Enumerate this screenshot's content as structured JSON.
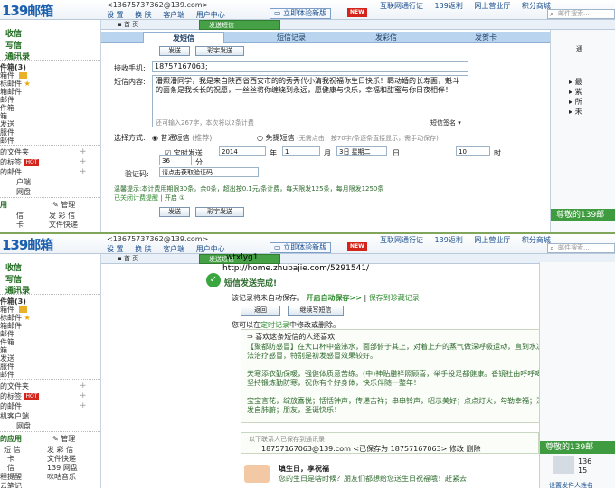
{
  "header": {
    "logo": "139邮箱",
    "account": "<13675737362@139.com>",
    "links": [
      "设 置",
      "换 肤",
      "客户端",
      "用户中心"
    ],
    "try_new": "立即体验新版",
    "new_badge": "NEW",
    "right_links": [
      "互联网通行证",
      "139返利",
      "网上营业厅",
      "积分商城"
    ],
    "search_placeholder": "邮件搜索..."
  },
  "sidebar_top": {
    "inbox": "收信",
    "compose": "写信",
    "contacts": "通讯录",
    "folders": "件箱(3)",
    "items": [
      "箱件 ",
      "标邮件 ",
      "箱邮件",
      "邮件",
      "件箱",
      "箱",
      "发送",
      "服件",
      "邮件"
    ],
    "more_items": [
      "的文件夹",
      "的标签",
      "的邮件"
    ],
    "hot": "HOT",
    "apps": [
      "户端",
      "网盘"
    ],
    "apps_title": "用",
    "manage": "管理",
    "grid": [
      "信",
      "卡",
      "发 彩 信",
      "文件快递"
    ]
  },
  "sidebar_bottom": {
    "inbox": "收信",
    "compose": "写信",
    "contacts": "通讯录",
    "folders": "件箱(3)",
    "items": [
      "箱件 ",
      "标邮件 ",
      "箱邮件",
      "邮件",
      "件箱",
      "箱",
      "发送",
      "服件",
      "邮件"
    ],
    "more_items": [
      "的文件夹",
      "的标签",
      "的邮件"
    ],
    "apps": [
      "机客户端",
      "网盘"
    ],
    "apps_title": "的应用",
    "manage": "管理",
    "grid": [
      "短 信",
      "发 彩 信",
      "卡",
      "文件快递",
      "信",
      "139 网盘",
      "程提醒",
      "咪咕音乐",
      "云笔记"
    ]
  },
  "tabs_top": [
    "首 页",
    "发送短信"
  ],
  "tabs_bottom": [
    "首 页",
    "发送短信"
  ],
  "sms": {
    "subtabs": [
      "发短信",
      "短信记录",
      "发彩信",
      "发贺卡"
    ],
    "send": "发送",
    "sms_send": "彩宇发送",
    "to_label": "接收手机:",
    "to_value": "18757167063;",
    "content_label": "短信内容:",
    "content_value": "潘照潘同学，我是来自陕西省西安市的的秀秀代小清我祝福你生日快乐！羁动婚的长寿面，魁斗的面条是我长长的祝愿，一丝丝将你缠绕到永远，愿健康与快乐，幸福和甜蜜与你日夜相伴！",
    "char_count": "还可输入267字，本次将以2条计费",
    "signature": "短信签名 ▾",
    "mode_label": "选择方式:",
    "mode_normal": "普通短信",
    "mode_normal_note": "(推荐)",
    "mode_free": "免提短信",
    "mode_free_note": "(无需点击，按70字/条逐条直接显示，需手动保存)",
    "timed": "定时发送",
    "year": "2014",
    "year_unit": "年",
    "month": "1",
    "month_unit": "月",
    "day": "3日 星期二",
    "day_unit": "日",
    "hour": "10",
    "hour_unit": "时",
    "minute": "36",
    "minute_unit": "分",
    "verify_label": "验证码:",
    "verify_value": "请点击获取验证码",
    "tip": "温馨提示:本计费用期限30条，余0条，超出按0.1元/条计费，每天限发125条，每月限发1250条",
    "link_open": "已关闭计费提醒",
    "link_sep": "|",
    "link_on": "开启",
    "link_x": "①",
    "send2": "发送",
    "sms_send2": "彩宇发送"
  },
  "success": {
    "title": "短信发送完成!",
    "auto_save": "该记录将未自动保存。",
    "auto_link": "开启自动保存>>",
    "sep": "|",
    "save_link": "保存到珍藏记录",
    "back_btn": "返回",
    "continue_btn": "继续写短信",
    "hint_pre": "您可以在",
    "hint_link": "定时记录",
    "hint_post": "中修改或删除。",
    "fav_title": "喜欢这条短信的人还喜欢",
    "fav_1": "【聚都防感冒】在大口杯中盛沸水，面部俯于其上，对着上升的蒸气做深呼吸运动，直到水凉为止，每日数次。此法治疗感冒，特别是初发感冒效果较好。",
    "fav_2": "天寒添衣勤保暖，强健体质意苦练。(中)神贴腊祥照顾喜，举手投足都健康。香镜社由呼呼喝，保暖身体要锻炼，坚持锻炼勤防寒，祝你有个好身体，快乐伴随一整年！",
    "fav_3": "宝宝言花，绽放喜悦；恬恬钟声，传递吉祥；串串铃声，昭示美好；点点灯火，勾勒幸福；深深情谊，句句祝福，发自肺腑；朋友，圣诞快乐！",
    "contacts_title": "以下联系人已保存到通讯录",
    "contact_line": "18757167063@139.com <已保存为  18757167063> 修改  删除",
    "bday_title": "填生日，享祝福",
    "bday_text": "您的生日是啥时候？朋友们都想给您送生日祝福哦！赶紧去",
    "greet": "尊敬的139邮",
    "greet_sub": "设置发件人姓名",
    "side_num": "136",
    "side_num2": "15"
  },
  "watermark": {
    "line1": "wtxlyg1",
    "line2": "http://home.zhubajie.com/5291541/"
  },
  "right_top": {
    "title": "通",
    "items": [
      "最",
      "紫",
      "所",
      "未"
    ],
    "greet": "尊敬的139邮"
  }
}
